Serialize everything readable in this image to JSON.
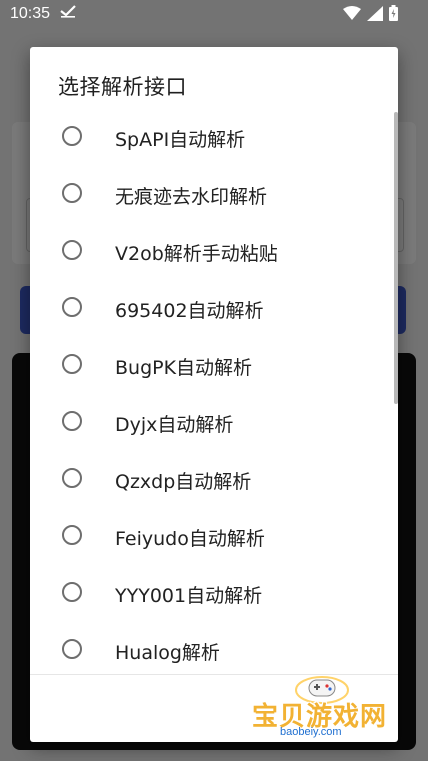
{
  "status_bar": {
    "time": "10:35",
    "icons": [
      "check-icon",
      "wifi-icon",
      "signal-icon",
      "battery-icon"
    ]
  },
  "dialog": {
    "title": "选择解析接口",
    "options": [
      {
        "label": "SpAPI自动解析",
        "selected": false
      },
      {
        "label": "无痕迹去水印解析",
        "selected": false
      },
      {
        "label": "V2ob解析手动粘贴",
        "selected": false
      },
      {
        "label": "695402自动解析",
        "selected": false
      },
      {
        "label": "BugPK自动解析",
        "selected": false
      },
      {
        "label": "Dyjx自动解析",
        "selected": false
      },
      {
        "label": "Qzxdp自动解析",
        "selected": false
      },
      {
        "label": "Feiyudo自动解析",
        "selected": false
      },
      {
        "label": "YYY001自动解析",
        "selected": false
      },
      {
        "label": "Hualog解析",
        "selected": false
      }
    ]
  },
  "watermark": {
    "name": "宝贝游戏网",
    "url": "baobeiy.com"
  },
  "colors": {
    "accent_blue": "#3d59c8",
    "watermark_yellow": "#f2b233",
    "radio_border": "#6e6e6e"
  }
}
